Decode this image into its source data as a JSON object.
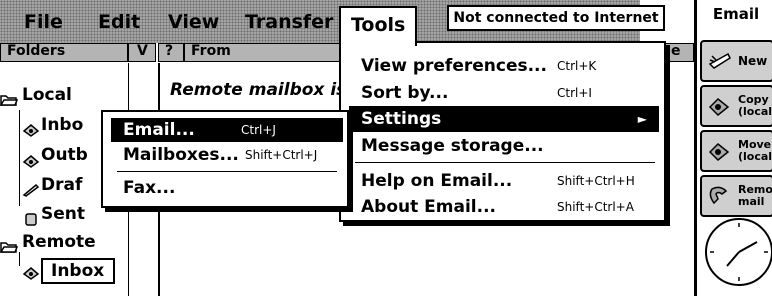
{
  "menubar": {
    "items": [
      {
        "label": "File"
      },
      {
        "label": "Edit"
      },
      {
        "label": "View"
      },
      {
        "label": "Transfer"
      },
      {
        "label": "Tools"
      }
    ],
    "status": "Not connected to Internet"
  },
  "headers": {
    "folders": "Folders",
    "sort_marker": "V",
    "flag": "?",
    "from": "From",
    "right": "e"
  },
  "folders": {
    "local": "Local",
    "inbox": "Inbo",
    "outbox": "Outb",
    "drafts": "Draf",
    "sent": "Sent",
    "remote": "Remote",
    "remote_inbox": "Inbox"
  },
  "main": {
    "message": "Remote mailbox is"
  },
  "tools_menu": {
    "items": [
      {
        "label": "View preferences...",
        "shortcut": "Ctrl+K"
      },
      {
        "label": "Sort by...",
        "shortcut": "Ctrl+I"
      },
      {
        "label": "Settings",
        "shortcut": "",
        "submenu_arrow": "►"
      },
      {
        "label": "Message storage...",
        "shortcut": ""
      },
      {
        "label": "Help on Email...",
        "shortcut": "Shift+Ctrl+H"
      },
      {
        "label": "About Email...",
        "shortcut": "Shift+Ctrl+A"
      }
    ]
  },
  "settings_submenu": {
    "items": [
      {
        "label": "Email...",
        "shortcut": "Ctrl+J"
      },
      {
        "label": "Mailboxes...",
        "shortcut": "Shift+Ctrl+J"
      },
      {
        "label": "Fax...",
        "shortcut": ""
      }
    ]
  },
  "toolbar": {
    "title": "Email",
    "buttons": [
      {
        "label1": "New",
        "label2": "",
        "icon": "new-mail-icon"
      },
      {
        "label1": "Copy",
        "label2": "(local)",
        "icon": "copy-icon"
      },
      {
        "label1": "Move",
        "label2": "(local)",
        "icon": "move-icon"
      },
      {
        "label1": "Remote",
        "label2": "mail",
        "icon": "phone-icon"
      }
    ]
  },
  "colors": {
    "menubar": "#a6a6a6",
    "highlight": "#000000",
    "button": "#cfcfcf"
  }
}
